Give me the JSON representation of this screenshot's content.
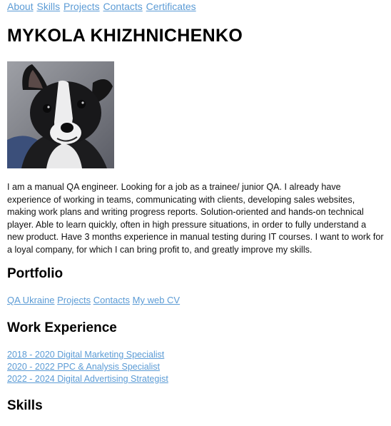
{
  "nav": {
    "items": [
      {
        "label": "About"
      },
      {
        "label": "Skills"
      },
      {
        "label": "Projects"
      },
      {
        "label": "Contacts"
      },
      {
        "label": "Certificates"
      }
    ]
  },
  "header": {
    "name": "MYKOLA KHIZHNICHENKO"
  },
  "profile": {
    "photo_icon": "dog-photo",
    "about": "I am a manual QA engineer. Looking for a job as a trainee/ junior QA. I already have experience of working in teams, communicating with clients, developing sales websites, making work plans and writing progress reports. Solution-oriented and hands-on technical player. Able to learn quickly, often in high pressure situations, in order to fully understand a new product. Have 3 months experience in manual testing during IT courses. I want to work for a loyal company, for which I can bring profit to, and greatly improve my skills."
  },
  "portfolio": {
    "title": "Portfolio",
    "links": [
      {
        "label": "QA Ukraine"
      },
      {
        "label": "Projects"
      },
      {
        "label": "Contacts"
      },
      {
        "label": "My web CV"
      }
    ]
  },
  "work": {
    "title": "Work Experience",
    "items": [
      {
        "label": "2018 - 2020 Digital Marketing Specialist"
      },
      {
        "label": "2020 - 2022 PPC & Analysis Specialist"
      },
      {
        "label": "2022 - 2024 Digital Advertising Strategist"
      }
    ]
  },
  "skills": {
    "title": "Skills"
  },
  "colors": {
    "link": "#5b9bd5",
    "text": "#111111",
    "heading": "#000000",
    "background": "#ffffff"
  }
}
